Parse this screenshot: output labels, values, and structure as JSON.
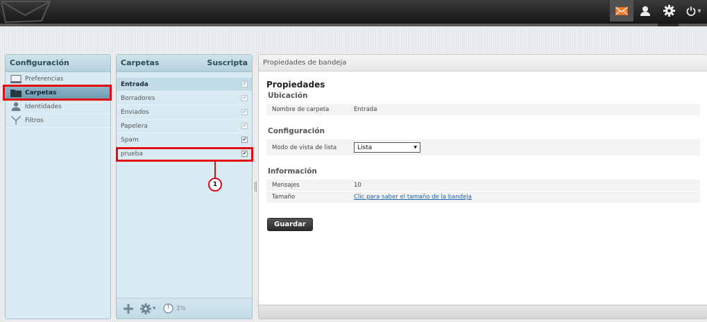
{
  "topbar": {
    "icons": [
      "mail-icon",
      "user-icon",
      "gear-icon",
      "power-icon"
    ]
  },
  "settings_panel": {
    "title": "Configuración",
    "items": [
      {
        "label": "Preferencias",
        "icon": "monitor-icon"
      },
      {
        "label": "Carpetas",
        "icon": "folder-icon"
      },
      {
        "label": "Identidades",
        "icon": "identity-icon"
      },
      {
        "label": "Filtros",
        "icon": "filter-icon"
      }
    ]
  },
  "folders_panel": {
    "title": "Carpetas",
    "subscribed_header": "Suscripta",
    "folders": [
      {
        "name": "Entrada",
        "subscribed": true
      },
      {
        "name": "Borradores",
        "subscribed": true
      },
      {
        "name": "Enviados",
        "subscribed": true
      },
      {
        "name": "Papelera",
        "subscribed": true
      },
      {
        "name": "Spam",
        "subscribed": true
      },
      {
        "name": "prueba",
        "subscribed": true
      }
    ],
    "quota": "3%"
  },
  "callout": {
    "number": "1"
  },
  "props_panel": {
    "header": "Propiedades de bandeja",
    "title": "Propiedades",
    "location": {
      "section": "Ubicación",
      "folder_name_label": "Nombre de carpeta",
      "folder_name_value": "Entrada"
    },
    "config": {
      "section": "Configuración",
      "list_view_label": "Modo de vista de lista",
      "list_view_value": "Lista"
    },
    "info": {
      "section": "Información",
      "messages_label": "Mensajes",
      "messages_value": "10",
      "size_label": "Tamaño",
      "size_link": "Clic para saber el tamaño de la bandeja"
    },
    "save_label": "Guardar"
  },
  "colors": {
    "accent": "#e00a15",
    "panel_bg": "#d8ebf3",
    "selected": "#7ea8bd",
    "mail_icon": "#f07b28"
  }
}
